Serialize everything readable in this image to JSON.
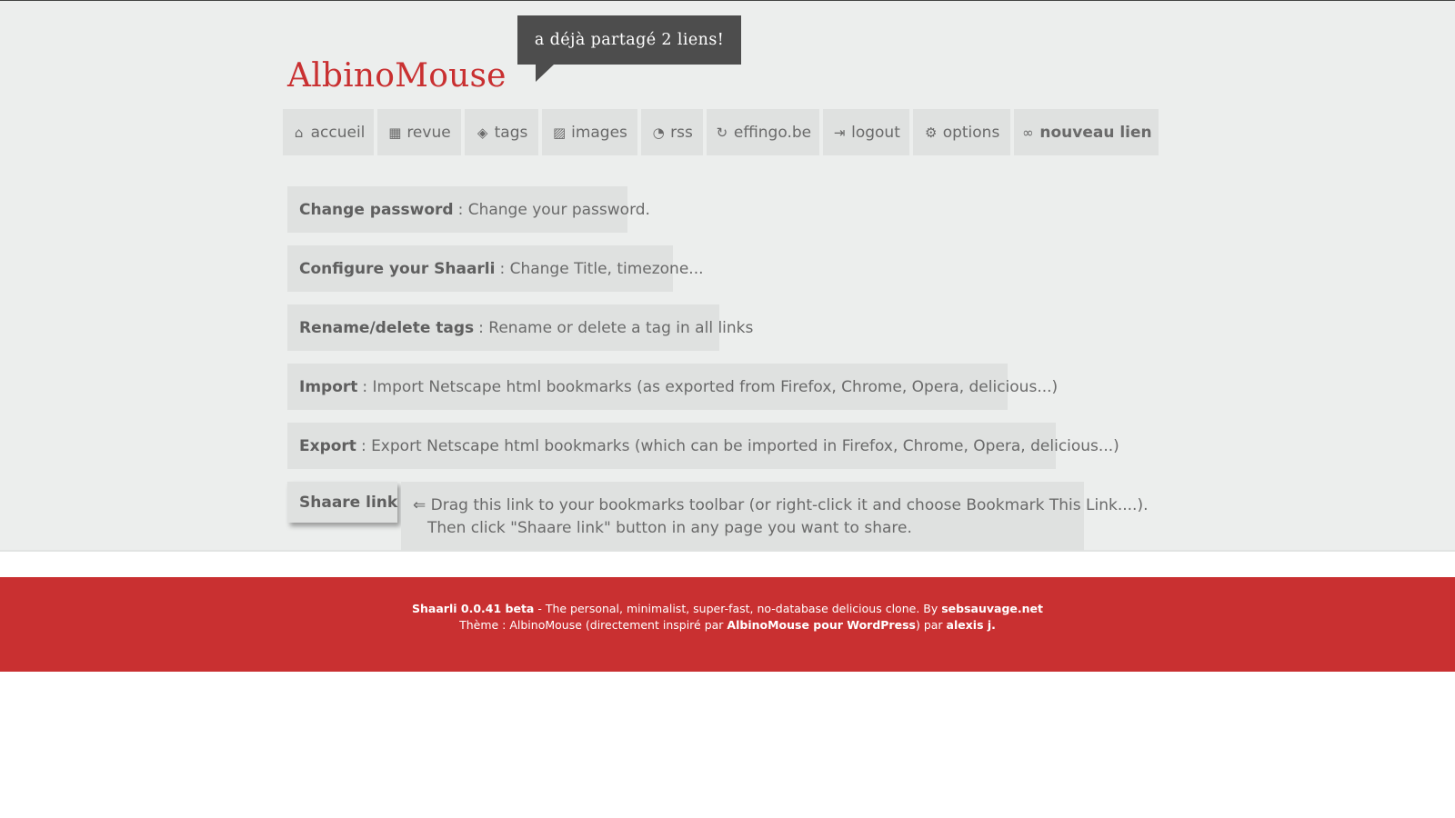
{
  "site": {
    "title": "AlbinoMouse",
    "bubble": "a déjà partagé 2 liens!"
  },
  "nav": [
    {
      "icon": "home-icon",
      "glyph": "⌂",
      "label": "accueil"
    },
    {
      "icon": "grid-icon",
      "glyph": "▦",
      "label": "revue"
    },
    {
      "icon": "tags-icon",
      "glyph": "◈",
      "label": "tags"
    },
    {
      "icon": "image-icon",
      "glyph": "▨",
      "label": "images"
    },
    {
      "icon": "rss-icon",
      "glyph": "◔",
      "label": "rss"
    },
    {
      "icon": "refresh-icon",
      "glyph": "↻",
      "label": "effingo.be"
    },
    {
      "icon": "logout-icon",
      "glyph": "⇥",
      "label": "logout"
    },
    {
      "icon": "gears-icon",
      "glyph": "⚙",
      "label": "options"
    },
    {
      "icon": "link-icon",
      "glyph": "∞",
      "label": "nouveau lien"
    }
  ],
  "options": [
    {
      "title": "Change password",
      "desc": ": Change your password."
    },
    {
      "title": "Configure your Shaarli",
      "desc": ": Change Title, timezone..."
    },
    {
      "title": "Rename/delete tags",
      "desc": ": Rename or delete a tag in all links"
    },
    {
      "title": "Import",
      "desc": ": Import Netscape html bookmarks (as exported from Firefox, Chrome, Opera, delicious...)"
    },
    {
      "title": "Export",
      "desc": ": Export Netscape html bookmarks (which can be imported in Firefox, Chrome, Opera, delicious...)"
    }
  ],
  "shaare": {
    "button": "Shaare link",
    "help_line1": "⇐ Drag this link to your bookmarks toolbar (or right-click it and choose Bookmark This Link....).",
    "help_line2": "Then click \"Shaare link\" button in any page you want to share."
  },
  "footer": {
    "version": "Shaarli 0.0.41 beta",
    "tagline": " - The personal, minimalist, super-fast, no-database delicious clone. By ",
    "author_link": "sebsauvage.net",
    "theme_prefix": "Thème : AlbinoMouse (directement inspiré par ",
    "theme_link": "AlbinoMouse pour WordPress",
    "theme_mid": ") par ",
    "theme_author": "alexis j."
  }
}
